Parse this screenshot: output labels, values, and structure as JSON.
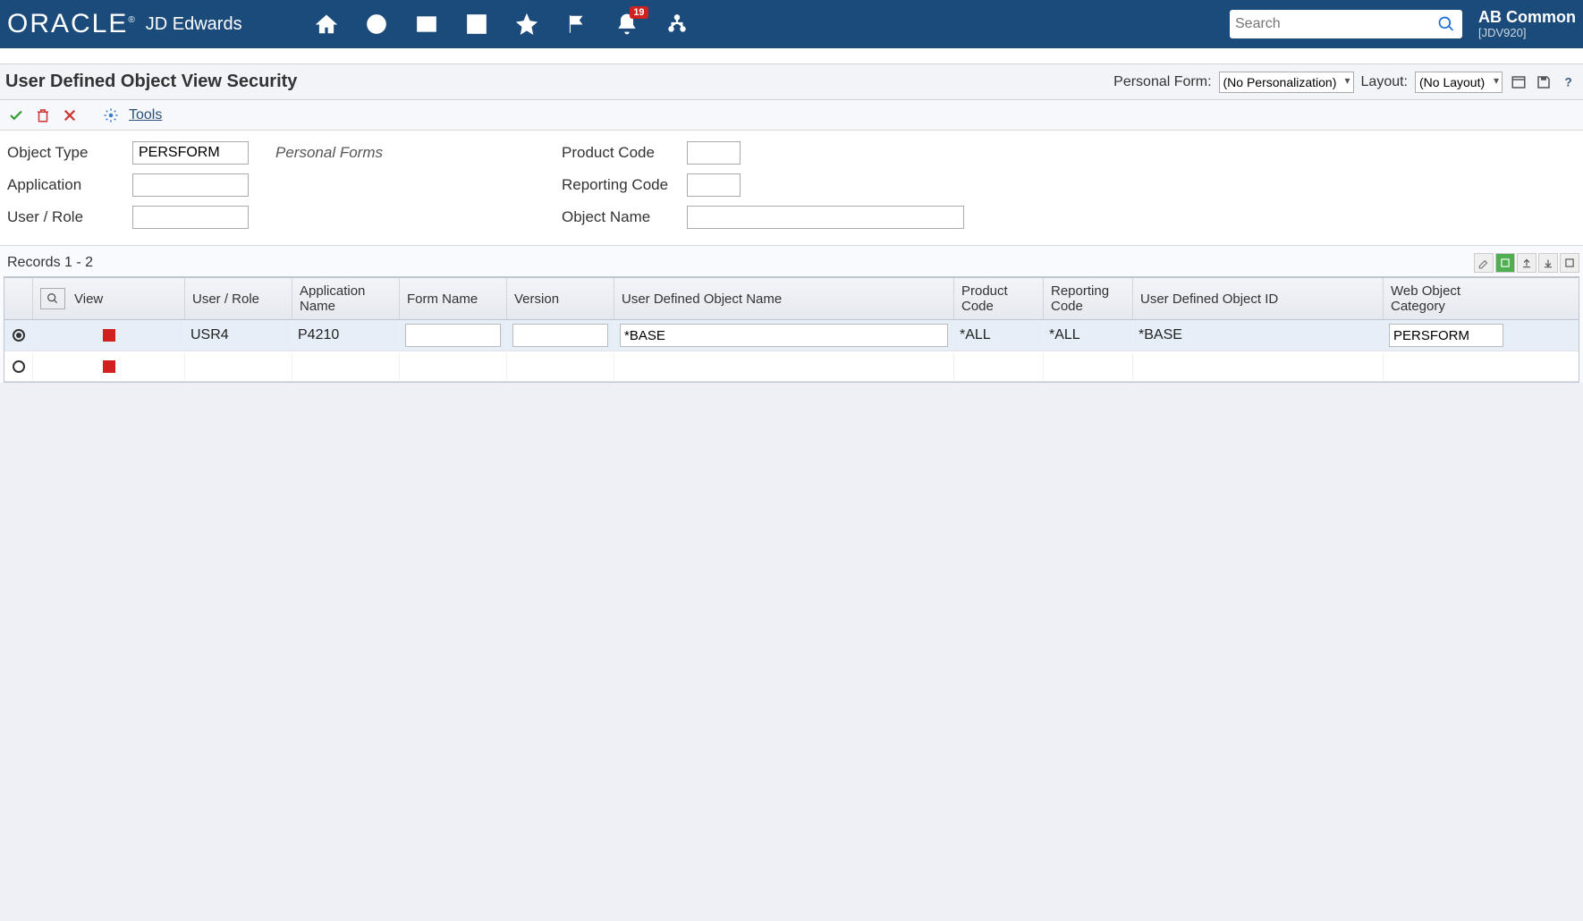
{
  "brand": {
    "logo": "ORACLE",
    "product": "JD Edwards"
  },
  "notifications": {
    "count": "19"
  },
  "search": {
    "placeholder": "Search"
  },
  "user": {
    "name": "AB Common",
    "env": "[JDV920]"
  },
  "page": {
    "title": "User Defined Object View Security",
    "personal_form_label": "Personal Form:",
    "personal_form_value": "(No Personalization)",
    "layout_label": "Layout:",
    "layout_value": "(No Layout)"
  },
  "toolbar": {
    "tools": "Tools"
  },
  "filters": {
    "object_type": {
      "label": "Object Type",
      "value": "PERSFORM",
      "desc": "Personal Forms"
    },
    "application": {
      "label": "Application",
      "value": ""
    },
    "user_role": {
      "label": "User / Role",
      "value": ""
    },
    "product_code": {
      "label": "Product Code",
      "value": ""
    },
    "reporting_code": {
      "label": "Reporting Code",
      "value": ""
    },
    "object_name": {
      "label": "Object Name",
      "value": ""
    }
  },
  "grid": {
    "records": "Records 1 - 2",
    "columns": {
      "view": "View",
      "user_role": "User / Role",
      "app_name": "Application Name",
      "form_name": "Form Name",
      "version": "Version",
      "udon": "User Defined Object Name",
      "product_code": "Product Code",
      "reporting_code": "Reporting Code",
      "udo_id": "User Defined Object ID",
      "web_obj_cat": "Web Object Category"
    },
    "rows": [
      {
        "selected": true,
        "user_role": "USR4",
        "app_name": "P4210",
        "form_name": "",
        "version": "",
        "udon": "*BASE",
        "product_code": "*ALL",
        "reporting_code": "*ALL",
        "udo_id": "*BASE",
        "web_obj_cat": "PERSFORM"
      },
      {
        "selected": false,
        "user_role": "",
        "app_name": "",
        "form_name": "",
        "version": "",
        "udon": "",
        "product_code": "",
        "reporting_code": "",
        "udo_id": "",
        "web_obj_cat": ""
      }
    ]
  }
}
